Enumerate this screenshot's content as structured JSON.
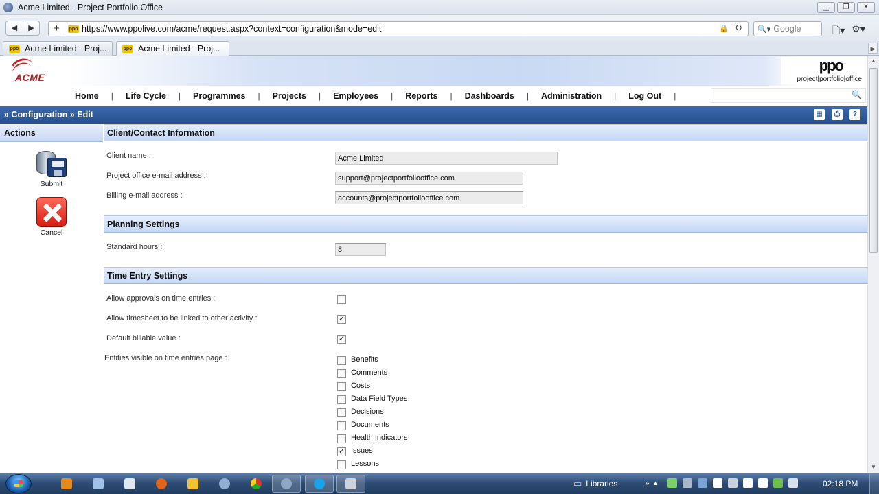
{
  "window": {
    "title": "Acme Limited - Project Portfolio Office"
  },
  "browser": {
    "url": "https://www.ppolive.com/acme/request.aspx?context=configuration&mode=edit",
    "search_placeholder": "Google",
    "tabs": [
      {
        "label": "Acme Limited - Proj..."
      },
      {
        "label": "Acme Limited - Proj..."
      }
    ]
  },
  "header": {
    "logo_left": "ACME",
    "logo_right_mark": "ppo",
    "logo_right_sub": "project|portfolio|office"
  },
  "menu": {
    "items": [
      "Home",
      "Life Cycle",
      "Programmes",
      "Projects",
      "Employees",
      "Reports",
      "Dashboards",
      "Administration",
      "Log Out"
    ],
    "separator": "|"
  },
  "breadcrumb": "» Configuration » Edit",
  "actions": {
    "heading": "Actions",
    "submit": "Submit",
    "cancel": "Cancel"
  },
  "sections": {
    "client": {
      "title": "Client/Contact Information",
      "client_name_label": "Client name :",
      "client_name": "Acme Limited",
      "office_email_label": "Project office e-mail address :",
      "office_email": "support@projectportfoliooffice.com",
      "billing_email_label": "Billing e-mail address :",
      "billing_email": "accounts@projectportfoliooffice.com"
    },
    "planning": {
      "title": "Planning Settings",
      "standard_hours_label": "Standard hours :",
      "standard_hours": "8"
    },
    "time_entry": {
      "title": "Time Entry Settings",
      "allow_approvals_label": "Allow approvals on time entries :",
      "allow_approvals": false,
      "allow_link_label": "Allow timesheet to be linked to other activity :",
      "allow_link": true,
      "default_billable_label": "Default billable value :",
      "default_billable": true,
      "entities_label": "Entities visible on time entries page :",
      "entities": [
        {
          "label": "Benefits",
          "checked": false
        },
        {
          "label": "Comments",
          "checked": false
        },
        {
          "label": "Costs",
          "checked": false
        },
        {
          "label": "Data Field Types",
          "checked": false
        },
        {
          "label": "Decisions",
          "checked": false
        },
        {
          "label": "Documents",
          "checked": false
        },
        {
          "label": "Health Indicators",
          "checked": false
        },
        {
          "label": "Issues",
          "checked": true
        },
        {
          "label": "Lessons",
          "checked": false
        }
      ]
    }
  },
  "taskbar": {
    "libraries": "Libraries",
    "clock": "02:18 PM"
  }
}
